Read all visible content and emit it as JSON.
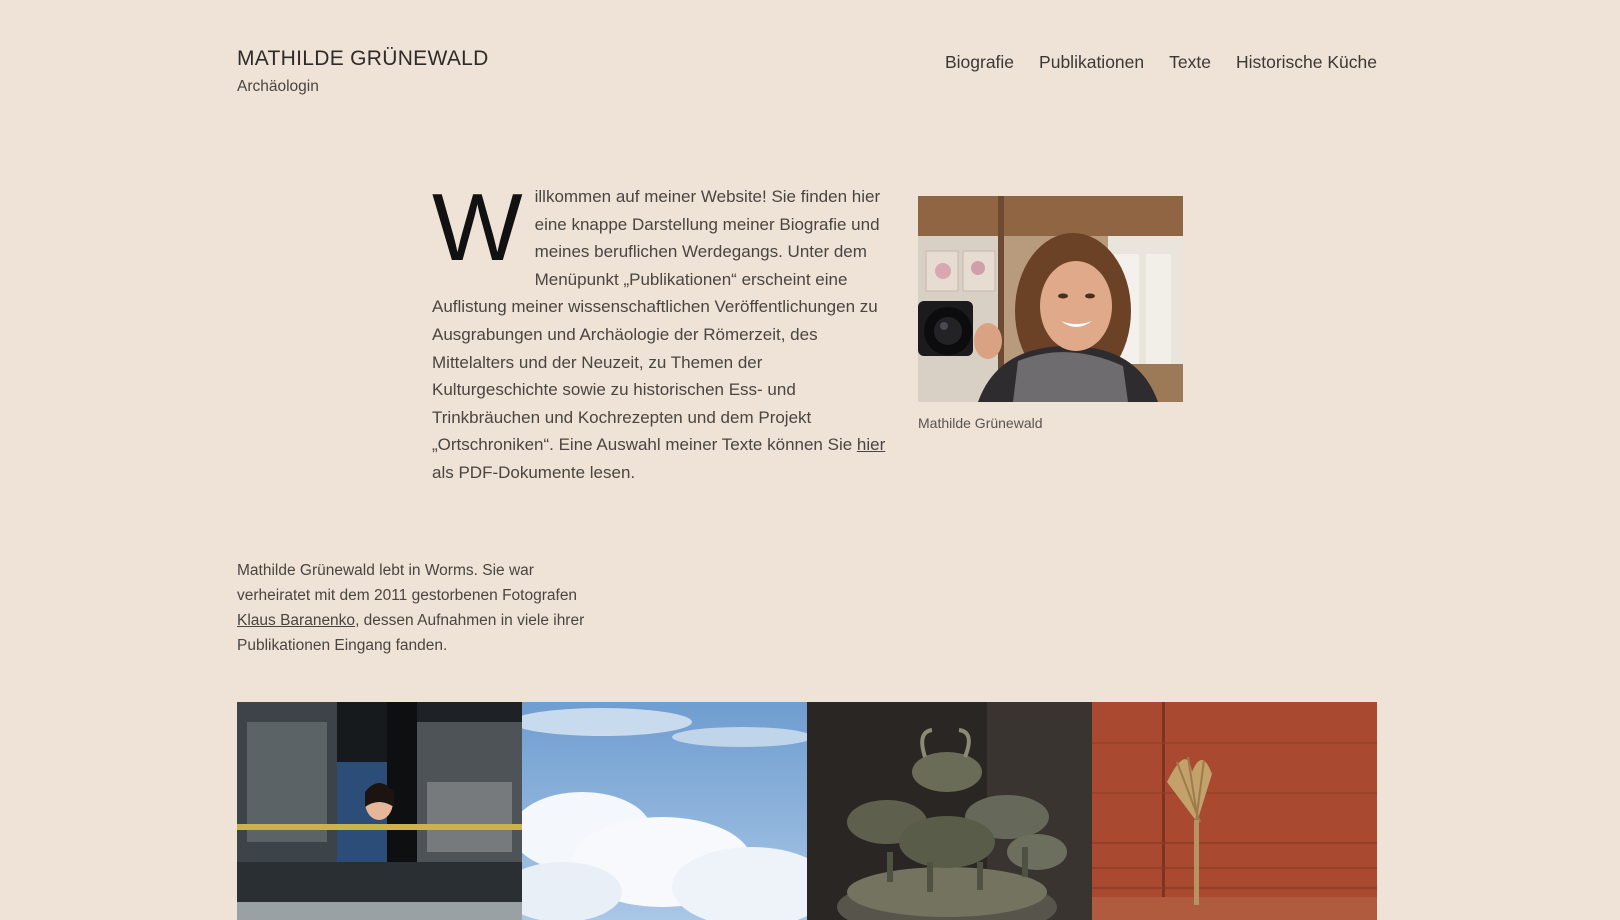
{
  "header": {
    "site_title": "MATHILDE GRÜNEWALD",
    "tagline": "Archäologin"
  },
  "nav": {
    "items": [
      {
        "label": "Biografie"
      },
      {
        "label": "Publikationen"
      },
      {
        "label": "Texte"
      },
      {
        "label": "Historische Küche"
      }
    ]
  },
  "intro": {
    "dropcap": "W",
    "text_before_link": "illkommen auf meiner Website! Sie finden hier eine knappe Darstellung meiner Biografie und meines beruflichen Werdegangs. Unter dem Menüpunkt „Publikationen“ erscheint eine Auflistung meiner wissenschaftlichen Veröffentlichungen zu Ausgrabungen und Archäologie der Römerzeit, des Mittelalters und der Neuzeit, zu Themen der Kulturgeschichte sowie zu historischen Ess- und Trinkbräuchen und Kochrezepten und dem Projekt „Ortschroniken“. Eine Auswahl meiner Texte können Sie ",
    "link_label": "hier ",
    "text_after_link": "als PDF-Dokumente lesen."
  },
  "portrait": {
    "caption": "Mathilde Grünewald"
  },
  "bio": {
    "text_before_link": "Mathilde Grünewald lebt in Worms. Sie war verheiratet mit dem 2011 gestorbenen Fotografen ",
    "link_label": "Klaus Baranenko",
    "text_after_link": ", dessen Aufnahmen in viele ihrer Publikationen Eingang fanden."
  },
  "colors": {
    "background": "#efe2d6",
    "text": "#3c3835",
    "dropcap": "#111111"
  }
}
